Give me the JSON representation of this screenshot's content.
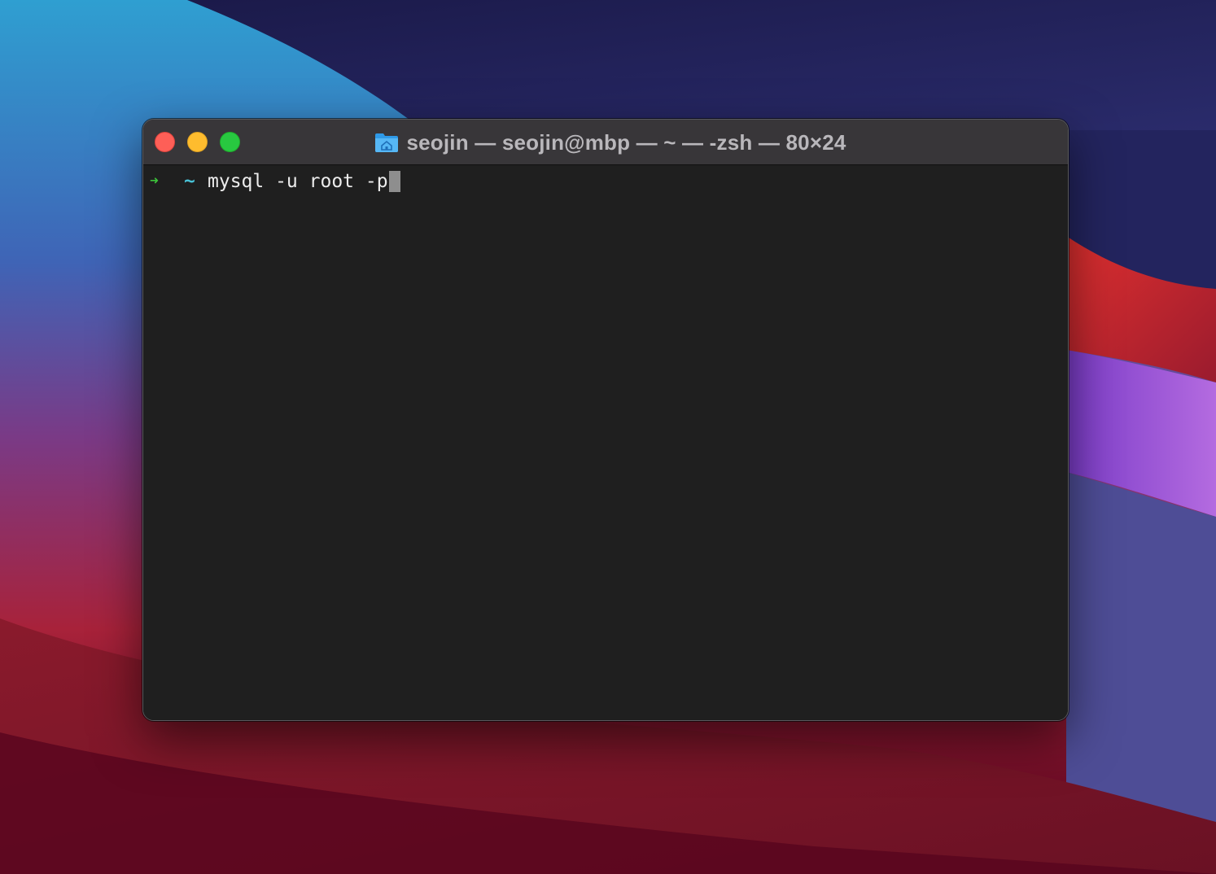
{
  "window": {
    "title": "seojin — seojin@mbp — ~ — -zsh — 80×24",
    "folder_icon": "home-folder-icon"
  },
  "traffic_lights": {
    "close": "#fe5f57",
    "minimize": "#febc2e",
    "zoom": "#28c840"
  },
  "terminal": {
    "prompt_arrow": "➜",
    "prompt_dir": "~",
    "command": "mysql -u root -p"
  },
  "colors": {
    "prompt_arrow": "#3cc23a",
    "prompt_dir": "#49c2d6",
    "terminal_bg": "#1f1f1f",
    "titlebar_bg": "#383639"
  }
}
